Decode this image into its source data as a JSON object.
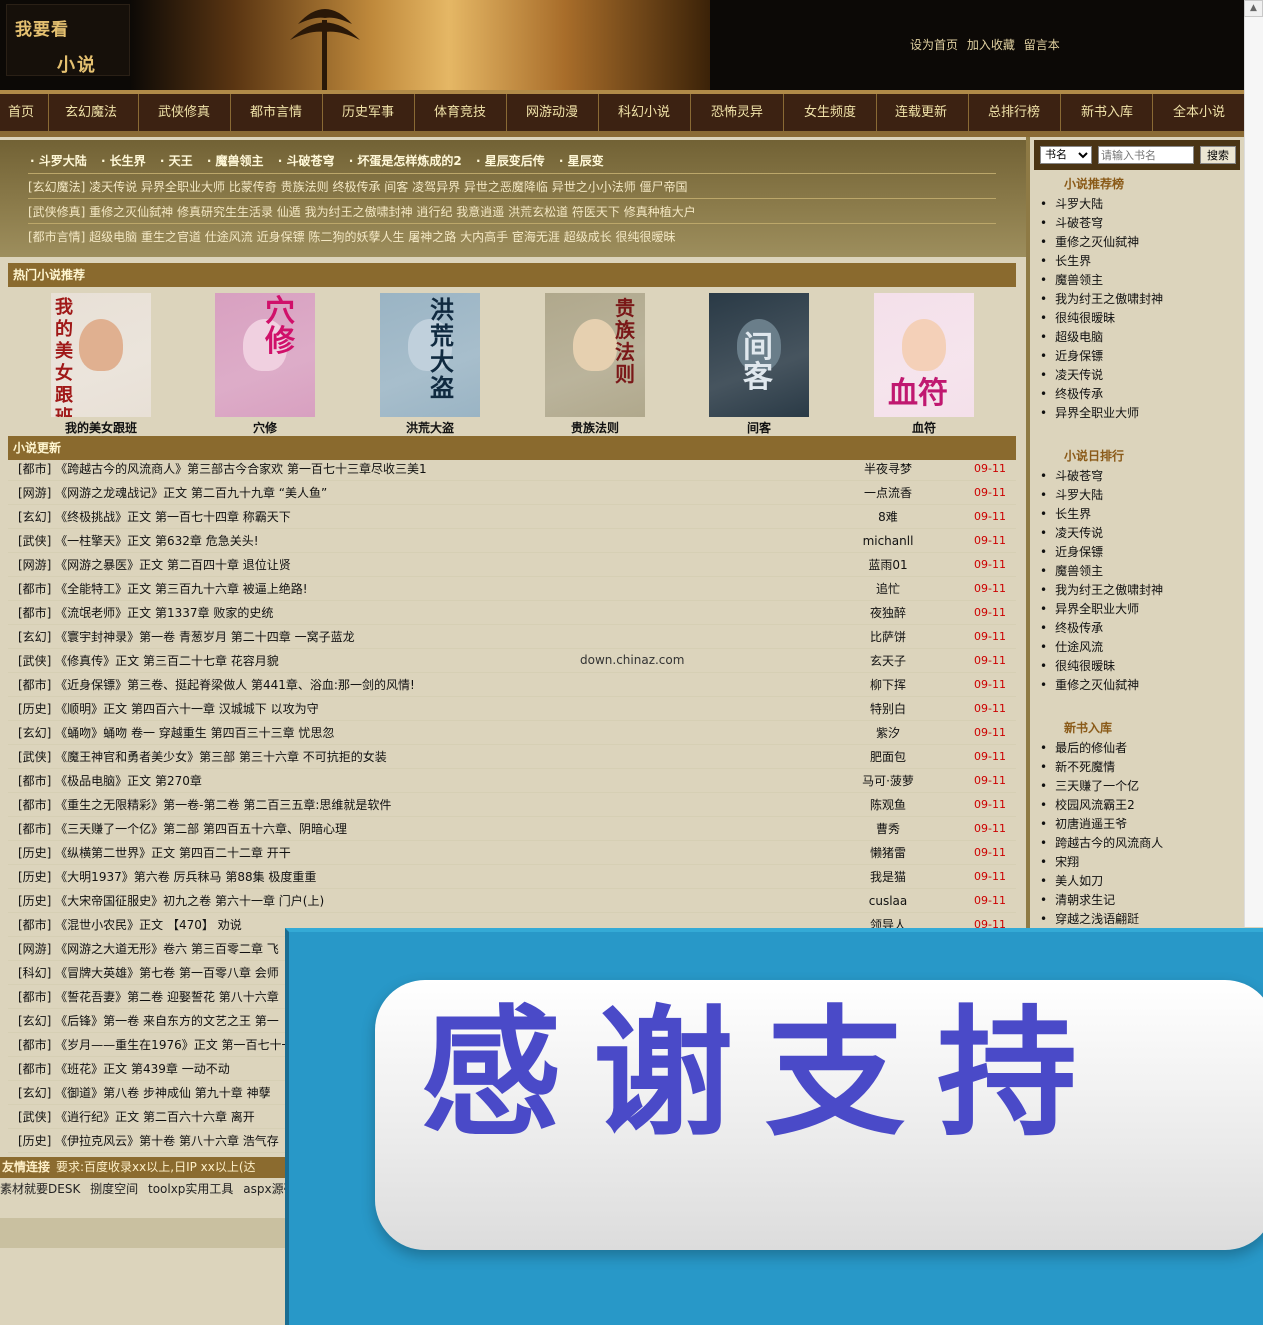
{
  "brand": {
    "logo_line1": "我要看",
    "logo_line2": "小说"
  },
  "toplinks": [
    "设为首页",
    "加入收藏",
    "留言本"
  ],
  "nav": [
    "首页",
    "玄幻魔法",
    "武侠修真",
    "都市言情",
    "历史军事",
    "体育竞技",
    "网游动漫",
    "科幻小说",
    "恐怖灵异",
    "女生频度",
    "连载更新",
    "总排行榜",
    "新书入库",
    "全本小说"
  ],
  "hot_row": [
    "· 斗罗大陆",
    "· 长生界",
    "· 天王",
    "· 魔兽领主",
    "· 斗破苍穹",
    "· 坏蛋是怎样炼成的2",
    "· 星辰变后传",
    "· 星辰变"
  ],
  "category_lines": [
    "[玄幻魔法] 凌天传说  异界全职业大师  比蒙传奇  贵族法则  终极传承  间客  凌驾异界  异世之恶魔降临  异世之小小法师  僵尸帝国",
    "[武侠修真] 重修之灭仙弑神  修真研究生生活录  仙遁  我为纣王之傲啸封神  逍行纪  我意逍遥  洪荒玄松道  符医天下  修真种植大户",
    "[都市言情] 超级电脑  重生之官道  仕途风流  近身保镖  陈二狗的妖孽人生  屠神之路  大内高手  宦海无涯  超级成长  很纯很暧昧"
  ],
  "hot_title": "热门小说推荐",
  "covers": [
    {
      "title": "我的美女跟班",
      "cover_text": "我的美女跟班",
      "bg": "#e8e0d6",
      "ink": "#a01818",
      "face": "#e0b090"
    },
    {
      "title": "穴修",
      "cover_text": "穴修",
      "bg": "#d8a0c0",
      "ink": "#d0106a",
      "face": "#f0d0e0"
    },
    {
      "title": "洪荒大盗",
      "cover_text": "洪荒大盗",
      "bg": "#9ab4c4",
      "ink": "#102a40",
      "face": "#c0d0dc"
    },
    {
      "title": "贵族法则",
      "cover_text": "贵族法则",
      "bg": "#b0a88c",
      "ink": "#7a1818",
      "face": "#e6d0b0"
    },
    {
      "title": "间客",
      "cover_text": "间客",
      "bg": "#2a3a46",
      "ink": "#e0e8ee",
      "face": "#6a7e8a"
    },
    {
      "title": "血符",
      "cover_text": "血符",
      "bg": "#f4e0ea",
      "ink": "#c01870",
      "face": "#f4d0b8"
    }
  ],
  "updates_title": "小说更新",
  "updates": [
    {
      "text": "[都市] 《跨越古今的风流商人》第三部古今合家欢  第一百七十三章尽收三美1",
      "author": "半夜寻梦",
      "date": "09-11"
    },
    {
      "text": "[网游] 《网游之龙魂战记》正文  第二百九十九章 “美人鱼”",
      "author": "一点流香",
      "date": "09-11"
    },
    {
      "text": "[玄幻] 《终极挑战》正文  第一百七十四章  称霸天下",
      "author": "8难",
      "date": "09-11"
    },
    {
      "text": "[武侠] 《一柱擎天》正文  第632章  危急关头!",
      "author": "michanll",
      "date": "09-11"
    },
    {
      "text": "[网游] 《网游之暴医》正文  第二百四十章  退位让贤",
      "author": "蓝雨01",
      "date": "09-11"
    },
    {
      "text": "[都市] 《全能特工》正文  第三百九十六章  被逼上绝路!",
      "author": "追忙",
      "date": "09-11"
    },
    {
      "text": "[都市] 《流氓老师》正文  第1337章  败家的史统",
      "author": "夜独醉",
      "date": "09-11"
    },
    {
      "text": "[玄幻] 《寰宇封神录》第一卷  青葱岁月  第二十四章  一窝子蓝龙",
      "author": "比萨饼",
      "date": "09-11"
    },
    {
      "text": "[武侠] 《修真传》正文  第三百二十七章  花容月貌",
      "author": "玄天子",
      "date": "09-11"
    },
    {
      "text": "[都市] 《近身保镖》第三卷、挺起脊梁做人  第441章、浴血:那一剑的风情!",
      "author": "柳下挥",
      "date": "09-11"
    },
    {
      "text": "[历史] 《顺明》正文  第四百六十一章  汉城城下  以攻为守",
      "author": "特别白",
      "date": "09-11"
    },
    {
      "text": "[玄幻] 《蛹吻》蛹吻  卷一  穿越重生  第四百三十三章  忧思忽",
      "author": "紫汐",
      "date": "09-11"
    },
    {
      "text": "[武侠] 《魔王神官和勇者美少女》第三部  第三十六章  不可抗拒的女装",
      "author": "肥面包",
      "date": "09-11"
    },
    {
      "text": "[都市] 《极品电脑》正文  第270章",
      "author": "马可·菠萝",
      "date": "09-11"
    },
    {
      "text": "[都市] 《重生之无限精彩》第一卷-第二卷  第二百三五章:思维就是软件",
      "author": "陈观鱼",
      "date": "09-11"
    },
    {
      "text": "[都市] 《三天赚了一个亿》第二部  第四百五十六章、阴暗心理",
      "author": "曹秀",
      "date": "09-11"
    },
    {
      "text": "[历史] 《纵横第二世界》正文  第四百二十二章  开干",
      "author": "懒猪雷",
      "date": "09-11"
    },
    {
      "text": "[历史] 《大明1937》第六卷  厉兵秣马  第88集  极度重重",
      "author": "我是猫",
      "date": "09-11"
    },
    {
      "text": "[历史] 《大宋帝国征服史》初九之卷  第六十一章  门户(上)",
      "author": "cuslaa",
      "date": "09-11"
    },
    {
      "text": "[都市] 《混世小农民》正文  【470】  劝说",
      "author": "领导人",
      "date": "09-11"
    },
    {
      "text": "[网游] 《网游之大道无形》卷六  第三百零二章  飞",
      "author": "",
      "date": ""
    },
    {
      "text": "[科幻] 《冒牌大英雄》第七卷  第一百零八章  会师",
      "author": "",
      "date": ""
    },
    {
      "text": "[都市] 《誓花吾妻》第二卷  迎娶誓花  第八十六章",
      "author": "",
      "date": ""
    },
    {
      "text": "[玄幻] 《后锋》第一卷  来自东方的文艺之王  第一",
      "author": "",
      "date": ""
    },
    {
      "text": "[都市] 《岁月——重生在1976》正文  第一百七十一",
      "author": "",
      "date": ""
    },
    {
      "text": "[都市] 《班花》正文  第439章  一动不动",
      "author": "",
      "date": ""
    },
    {
      "text": "[玄幻] 《御道》第八卷  步神成仙  第九十章  神孽",
      "author": "",
      "date": ""
    },
    {
      "text": "[武侠] 《逍行纪》正文  第二百六十六章  离开",
      "author": "",
      "date": ""
    },
    {
      "text": "[历史] 《伊拉克风云》第十卷  第八十六章  浩气存",
      "author": "",
      "date": ""
    }
  ],
  "watermark": "down.chinaz.com",
  "friends": {
    "label": "友情连接",
    "text": "要求:百度收录xx以上,日IP xx以上(达"
  },
  "friend_links": [
    "素材就要DESK",
    "捌度空间",
    "toolxp实用工具",
    "aspx源码吧"
  ],
  "search": {
    "select": "书名",
    "placeholder": "请输入书名",
    "button": "搜索"
  },
  "sidebar": {
    "recommend_title": "小说推荐榜",
    "recommend": [
      "斗罗大陆",
      "斗破苍穹",
      "重修之灭仙弑神",
      "长生界",
      "魔兽领主",
      "我为纣王之傲啸封神",
      "很纯很暧昧",
      "超级电脑",
      "近身保镖",
      "凌天传说",
      "终极传承",
      "异界全职业大师"
    ],
    "daily_title": "小说日排行",
    "daily": [
      "斗破苍穹",
      "斗罗大陆",
      "长生界",
      "凌天传说",
      "近身保镖",
      "魔兽领主",
      "我为纣王之傲啸封神",
      "异界全职业大师",
      "终极传承",
      "仕途风流",
      "很纯很暧昧",
      "重修之灭仙弑神"
    ],
    "new_title": "新书入库",
    "new": [
      "最后的修仙者",
      "新不死魔情",
      "三天赚了一个亿",
      "校园风流霸王2",
      "初唐逍遥王爷",
      "跨越古今的风流商人",
      "宋翔",
      "美人如刀",
      "清朝求生记",
      "穿越之浅语翩跹"
    ]
  },
  "overlay": {
    "text": "感谢支持"
  },
  "colors": {
    "nav_bg": "#3c2212",
    "accent": "#8a6a2e",
    "date_red": "#cc0000",
    "overlay_blue": "#2898c8",
    "overlay_text": "#4a4ac8"
  }
}
